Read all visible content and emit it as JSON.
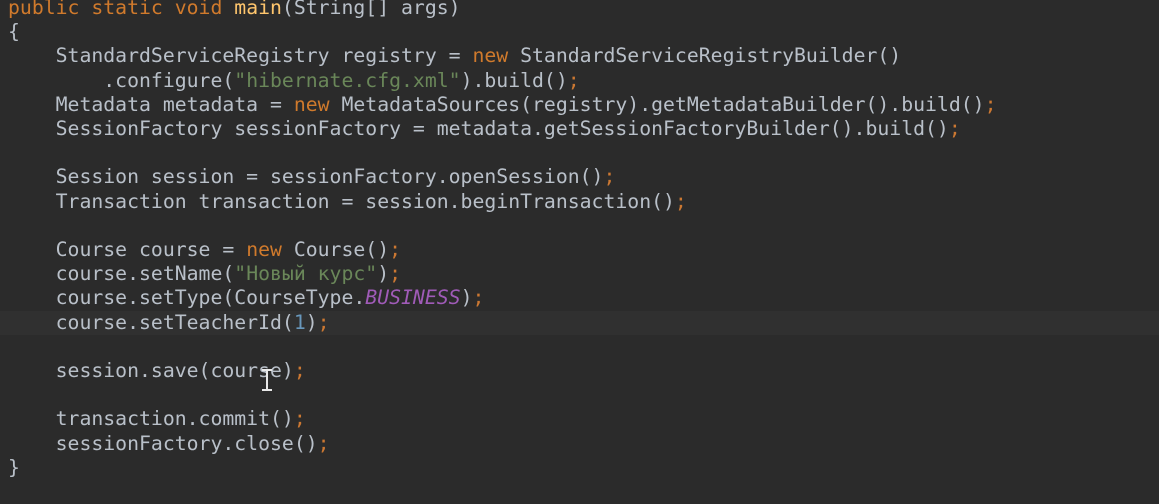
{
  "colors": {
    "background": "#2b2b2b",
    "text": "#b9c0c9",
    "keyword": "#d07a2c",
    "string": "#6a8759",
    "number": "#6897bb",
    "enum_constant": "#a05bb8",
    "current_line": "#303030"
  },
  "editor": {
    "lines": [
      {
        "tokens": [
          {
            "text": "public static void ",
            "k": "kw"
          },
          {
            "text": "main",
            "k": "mth"
          },
          {
            "text": "(String[] args)",
            "k": "t"
          }
        ]
      },
      {
        "tokens": [
          {
            "text": "{",
            "k": "t"
          }
        ]
      },
      {
        "tokens": [
          {
            "text": "    StandardServiceRegistry registry = ",
            "k": "t"
          },
          {
            "text": "new ",
            "k": "kw"
          },
          {
            "text": "StandardServiceRegistryBuilder()",
            "k": "t"
          }
        ]
      },
      {
        "tokens": [
          {
            "text": "        .configure(",
            "k": "t"
          },
          {
            "text": "\"hibernate.cfg.xml\"",
            "k": "str"
          },
          {
            "text": ").build()",
            "k": "t"
          },
          {
            "text": ";",
            "k": "punc"
          }
        ]
      },
      {
        "tokens": [
          {
            "text": "    Metadata metadata = ",
            "k": "t"
          },
          {
            "text": "new ",
            "k": "kw"
          },
          {
            "text": "MetadataSources(registry).getMetadataBuilder().build()",
            "k": "t"
          },
          {
            "text": ";",
            "k": "punc"
          }
        ]
      },
      {
        "tokens": [
          {
            "text": "    SessionFactory sessionFactory = metadata.getSessionFactoryBuilder().build()",
            "k": "t"
          },
          {
            "text": ";",
            "k": "punc"
          }
        ]
      },
      {
        "tokens": []
      },
      {
        "tokens": [
          {
            "text": "    Session session = sessionFactory.openSession()",
            "k": "t"
          },
          {
            "text": ";",
            "k": "punc"
          }
        ]
      },
      {
        "tokens": [
          {
            "text": "    Transaction transaction = session.beginTransaction()",
            "k": "t"
          },
          {
            "text": ";",
            "k": "punc"
          }
        ]
      },
      {
        "tokens": []
      },
      {
        "tokens": [
          {
            "text": "    Course course = ",
            "k": "t"
          },
          {
            "text": "new ",
            "k": "kw"
          },
          {
            "text": "Course()",
            "k": "t"
          },
          {
            "text": ";",
            "k": "punc"
          }
        ]
      },
      {
        "tokens": [
          {
            "text": "    course.setName(",
            "k": "t"
          },
          {
            "text": "\"Новый курс\"",
            "k": "str"
          },
          {
            "text": ")",
            "k": "t"
          },
          {
            "text": ";",
            "k": "punc"
          }
        ]
      },
      {
        "tokens": [
          {
            "text": "    course.setType(CourseType.",
            "k": "t"
          },
          {
            "text": "BUSINESS",
            "k": "enum"
          },
          {
            "text": ")",
            "k": "t"
          },
          {
            "text": ";",
            "k": "punc"
          }
        ]
      },
      {
        "current": true,
        "tokens": [
          {
            "text": "    course.setTeacherId(",
            "k": "t"
          },
          {
            "text": "1",
            "k": "num"
          },
          {
            "text": ")",
            "k": "t"
          },
          {
            "text": ";",
            "k": "punc"
          }
        ]
      },
      {
        "tokens": []
      },
      {
        "tokens": [
          {
            "text": "    session.save(course)",
            "k": "t"
          },
          {
            "text": ";",
            "k": "punc"
          }
        ]
      },
      {
        "tokens": []
      },
      {
        "tokens": [
          {
            "text": "    transaction.commit()",
            "k": "t"
          },
          {
            "text": ";",
            "k": "punc"
          }
        ]
      },
      {
        "tokens": [
          {
            "text": "    sessionFactory.close()",
            "k": "t"
          },
          {
            "text": ";",
            "k": "punc"
          }
        ]
      },
      {
        "tokens": [
          {
            "text": "}",
            "k": "t"
          }
        ]
      }
    ]
  }
}
